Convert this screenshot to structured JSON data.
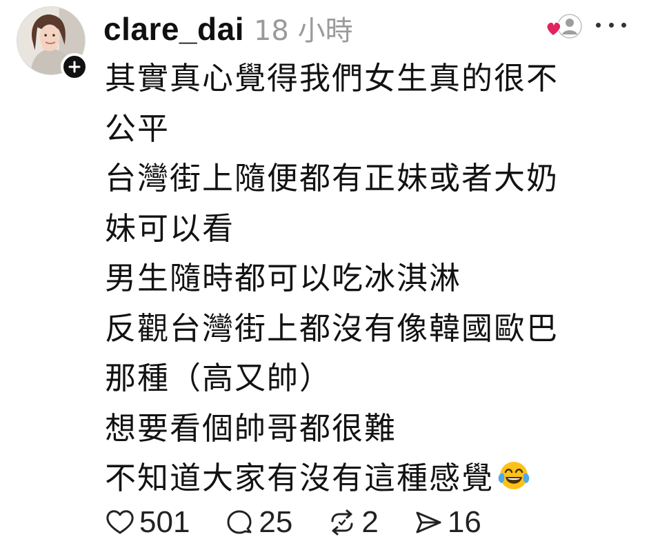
{
  "post": {
    "username": "clare_dai",
    "timestamp": "18 小時",
    "lines": [
      "其實真心覺得我們女生真的很不",
      "公平",
      "台灣街上隨便都有正妹或者大奶",
      "妹可以看",
      "男生隨時都可以吃冰淇淋",
      "反觀台灣街上都沒有像韓國歐巴",
      "那種（高又帥）",
      "想要看個帥哥都很難",
      "不知道大家有沒有這種感覺"
    ],
    "emoji": "face-with-tears-of-joy"
  },
  "actions": {
    "likes": "501",
    "replies": "25",
    "reposts": "2",
    "shares": "16"
  },
  "icons": {
    "avatar": "user-avatar",
    "follow": "plus-icon",
    "liked_by": "heart-user-icon",
    "more": "more-icon",
    "like": "heart-icon",
    "reply": "comment-icon",
    "repost": "repost-icon",
    "share": "send-icon"
  },
  "colors": {
    "text": "#121212",
    "muted": "#9a9a9a",
    "heart_red": "#e0245e",
    "badge": "#111111"
  }
}
